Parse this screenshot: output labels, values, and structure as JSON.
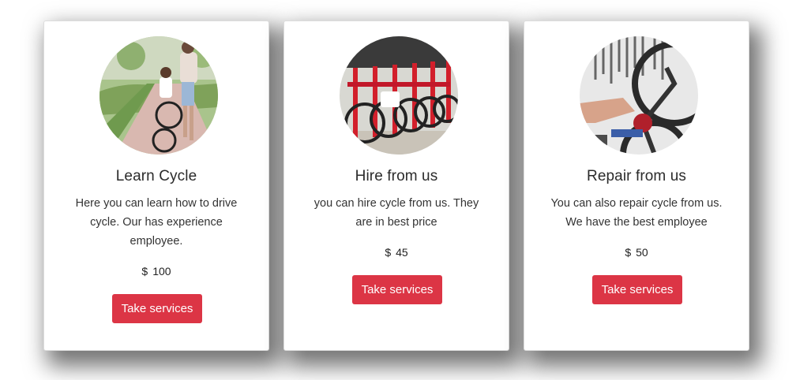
{
  "services": [
    {
      "title": "Learn Cycle",
      "description": "Here you can learn how to drive cycle. Our has experience employee.",
      "currency": "$",
      "price": "100",
      "button_label": "Take services",
      "image_icon": "father-child-cycling-photo"
    },
    {
      "title": "Hire from us",
      "description": "you can hire cycle from us. They are in best price",
      "currency": "$",
      "price": "45",
      "button_label": "Take services",
      "image_icon": "rental-bikes-row-photo"
    },
    {
      "title": "Repair from us",
      "description": "You can also repair cycle from us. We have the best employee",
      "currency": "$",
      "price": "50",
      "button_label": "Take services",
      "image_icon": "bike-repair-workshop-photo"
    }
  ],
  "colors": {
    "button": "#dc3545",
    "button_text": "#ffffff",
    "text": "#333333"
  }
}
